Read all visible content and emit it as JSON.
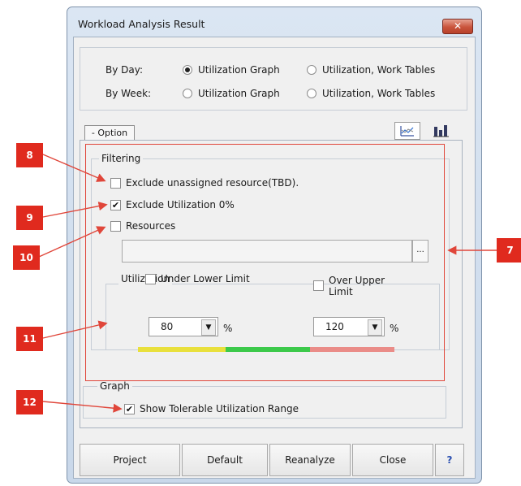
{
  "window": {
    "title": "Workload Analysis Result",
    "close_glyph": "✕"
  },
  "view": {
    "by_day_label": "By Day:",
    "by_week_label": "By Week:",
    "options": [
      "Utilization Graph",
      "Utilization, Work Tables"
    ],
    "by_day_selected": "Utilization Graph",
    "by_week_selected": null
  },
  "option_tab": {
    "label": "- Option"
  },
  "view_icons": [
    "line-chart-icon",
    "bar-chart-icon"
  ],
  "filtering": {
    "label": "Filtering",
    "exclude_unassigned": {
      "label": "Exclude unassigned resource(TBD).",
      "checked": false
    },
    "exclude_zero": {
      "label": "Exclude Utilization 0%",
      "checked": true
    },
    "resources": {
      "label": "Resources",
      "checked": false,
      "value": "",
      "browse_label": "..."
    }
  },
  "utilization": {
    "label": "Utilization",
    "under_lower": {
      "label": "Under Lower Limit",
      "checked": false,
      "value": "80",
      "unit": "%"
    },
    "over_upper": {
      "label": "Over Upper Limit",
      "checked": false,
      "value": "120",
      "unit": "%"
    },
    "range_colors": {
      "low": "#e9e03c",
      "ok": "#3cc94a",
      "high": "#ea8c88"
    }
  },
  "graph": {
    "label": "Graph",
    "show_tolerable": {
      "label": "Show Tolerable Utilization Range",
      "checked": true
    }
  },
  "buttons": {
    "project": "Project",
    "default": "Default",
    "reanalyze": "Reanalyze",
    "close": "Close",
    "help": "?"
  },
  "callouts": {
    "c7": "7",
    "c8": "8",
    "c9": "9",
    "c10": "10",
    "c11": "11",
    "c12": "12"
  }
}
